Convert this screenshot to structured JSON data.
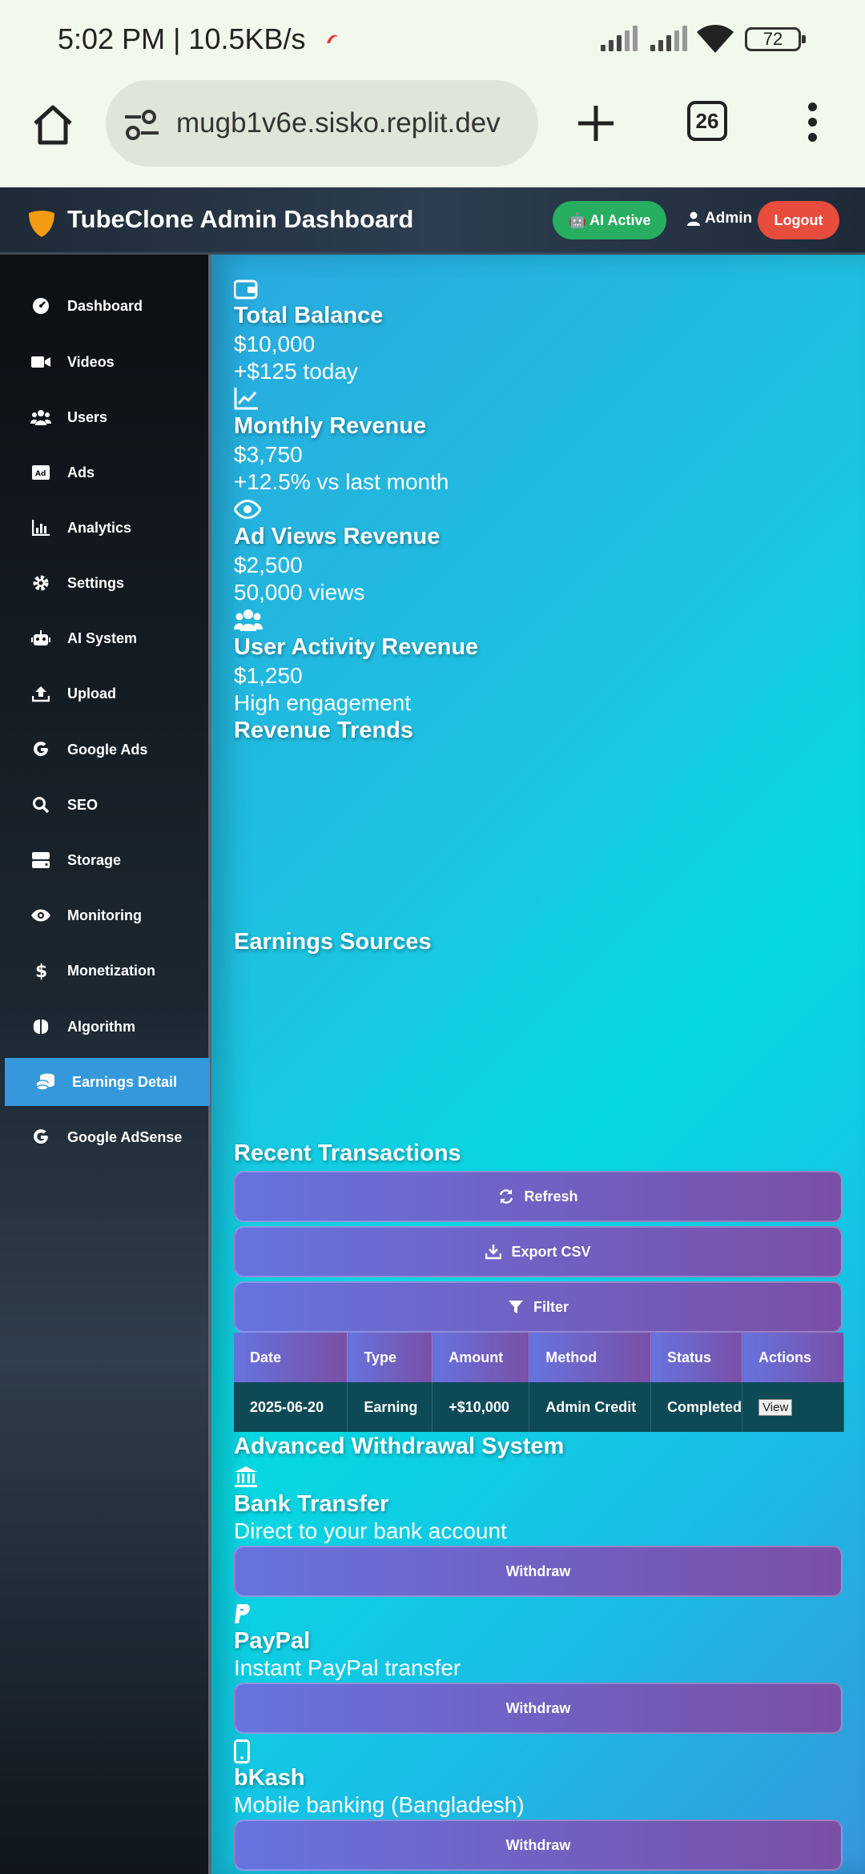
{
  "status_bar": {
    "time": "5:02 PM | 10.5KB/s",
    "battery": "72"
  },
  "browser": {
    "url": "mugb1v6e.sisko.replit.dev",
    "tab_count": "26"
  },
  "header": {
    "title": "TubeClone Admin Dashboard",
    "ai_badge": "🤖 AI Active",
    "user_label": "Admin",
    "logout_label": "Logout"
  },
  "sidebar": {
    "items": [
      {
        "label": "Dashboard",
        "icon": "gauge-icon"
      },
      {
        "label": "Videos",
        "icon": "video-icon"
      },
      {
        "label": "Users",
        "icon": "users-icon"
      },
      {
        "label": "Ads",
        "icon": "ad-icon"
      },
      {
        "label": "Analytics",
        "icon": "chart-bar-icon"
      },
      {
        "label": "Settings",
        "icon": "gear-icon"
      },
      {
        "label": "AI System",
        "icon": "robot-icon"
      },
      {
        "label": "Upload",
        "icon": "upload-icon"
      },
      {
        "label": "Google Ads",
        "icon": "google-icon"
      },
      {
        "label": "SEO",
        "icon": "search-icon"
      },
      {
        "label": "Storage",
        "icon": "hdd-icon"
      },
      {
        "label": "Monitoring",
        "icon": "eye-icon"
      },
      {
        "label": "Monetization",
        "icon": "dollar-icon"
      },
      {
        "label": "Algorithm",
        "icon": "brain-icon"
      },
      {
        "label": "Earnings Detail",
        "icon": "coins-icon",
        "active": true
      },
      {
        "label": "Google AdSense",
        "icon": "google-icon"
      }
    ]
  },
  "stats": [
    {
      "title": "Total Balance",
      "value": "$10,000",
      "sub": "+$125 today",
      "icon": "wallet-icon"
    },
    {
      "title": "Monthly Revenue",
      "value": "$3,750",
      "sub": "+12.5% vs last month",
      "icon": "chart-line-icon"
    },
    {
      "title": "Ad Views Revenue",
      "value": "$2,500",
      "sub": "50,000 views",
      "icon": "eye-icon"
    },
    {
      "title": "User Activity Revenue",
      "value": "$1,250",
      "sub": "High engagement",
      "icon": "users-icon"
    }
  ],
  "sections": {
    "revenue_trends": "Revenue Trends",
    "earnings_sources": "Earnings Sources",
    "recent_transactions": "Recent Transactions",
    "withdrawal_system": "Advanced Withdrawal System"
  },
  "transaction_actions": {
    "refresh": "Refresh",
    "export": "Export CSV",
    "filter": "Filter"
  },
  "transactions": {
    "headers": [
      "Date",
      "Type",
      "Amount",
      "Method",
      "Status",
      "Actions"
    ],
    "rows": [
      {
        "date": "2025-06-20",
        "type": "Earning",
        "amount": "+$10,000",
        "method": "Admin Credit",
        "status": "Completed",
        "action": "View"
      }
    ]
  },
  "withdrawals": [
    {
      "title": "Bank Transfer",
      "desc": "Direct to your bank account",
      "button": "Withdraw",
      "icon": "bank-icon"
    },
    {
      "title": "PayPal",
      "desc": "Instant PayPal transfer",
      "button": "Withdraw",
      "icon": "paypal-icon"
    },
    {
      "title": "bKash",
      "desc": "Mobile banking (Bangladesh)",
      "button": "Withdraw",
      "icon": "mobile-icon"
    }
  ],
  "colors": {
    "accent_green": "#27ae60",
    "logout_red": "#e74c3c",
    "active_nav": "#3498db",
    "button_gradient_start": "#6673df",
    "button_gradient_end": "#7a4fa6"
  }
}
